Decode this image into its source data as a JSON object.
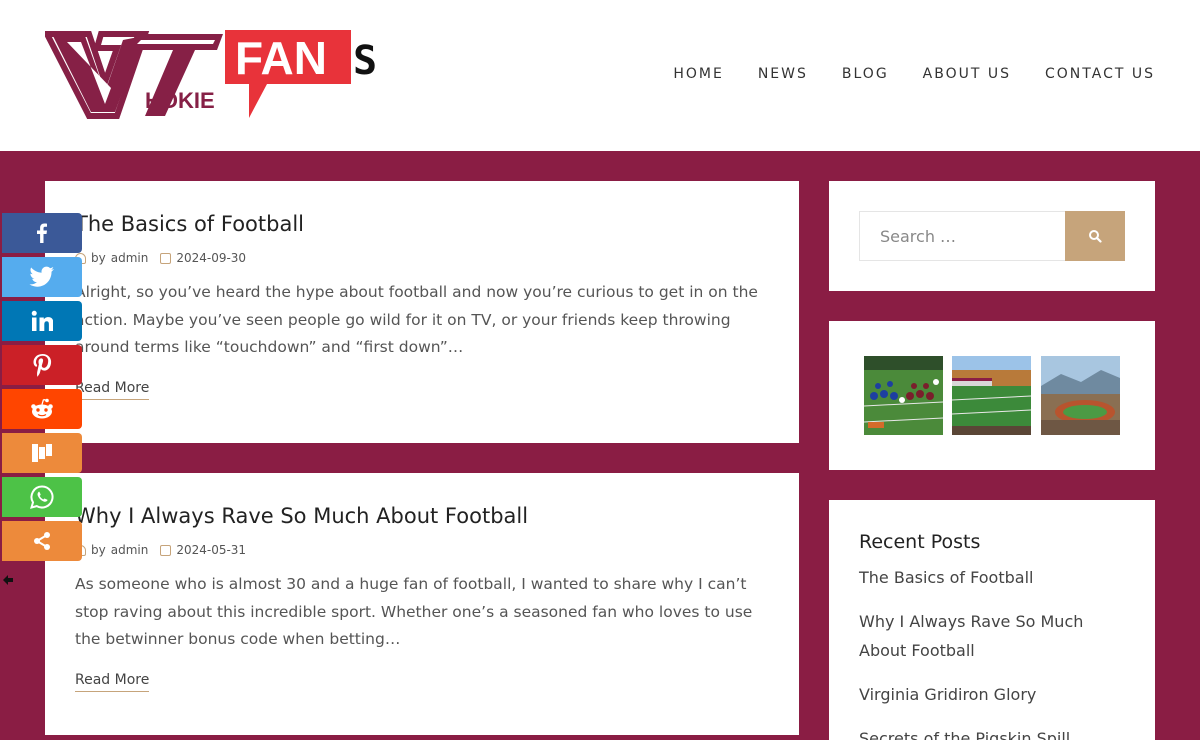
{
  "site": {
    "logo_text_vt": "VT",
    "logo_text_hokie": "HOKIE",
    "logo_text_fan": "FAN",
    "logo_text_s": "S"
  },
  "nav": {
    "items": [
      "HOME",
      "NEWS",
      "BLOG",
      "ABOUT US",
      "CONTACT US"
    ]
  },
  "posts": [
    {
      "title": "The Basics of Football",
      "author_prefix": "by",
      "author": "admin",
      "date": "2024-09-30",
      "excerpt": "Alright, so you’ve heard the hype about football and now you’re curious to get in on the action. Maybe you’ve seen people go wild for it on TV, or your friends keep throwing around terms like “touchdown” and “first down”…",
      "read_more": "Read More"
    },
    {
      "title": "Why I Always Rave So Much About Football",
      "author_prefix": "by",
      "author": "admin",
      "date": "2024-05-31",
      "excerpt": "As someone who is almost 30 and a huge fan of football, I wanted to share why I can’t stop raving about this incredible sport. Whether one’s a seasoned fan who loves to use the betwinner bonus code when betting…",
      "read_more": "Read More"
    }
  ],
  "sidebar": {
    "search": {
      "placeholder": "Search …"
    },
    "recent_posts": {
      "title": "Recent Posts",
      "items": [
        "The Basics of Football",
        "Why I Always Rave So Much About Football",
        "Virginia Gridiron Glory",
        "Secrets of the Pigskin Spill"
      ]
    }
  },
  "colors": {
    "background": "#8a1d44",
    "accent": "#c6a47b",
    "logo_maroon": "#862046",
    "logo_red": "#e8333a"
  },
  "share": {
    "buttons": [
      {
        "name": "facebook",
        "color": "#3b5998",
        "glyph": "f"
      },
      {
        "name": "twitter",
        "color": "#55acee",
        "glyph": "twitter"
      },
      {
        "name": "linkedin",
        "color": "#0077b5",
        "glyph": "in"
      },
      {
        "name": "pinterest",
        "color": "#cb2027",
        "glyph": "P"
      },
      {
        "name": "reddit",
        "color": "#ff4500",
        "glyph": "reddit"
      },
      {
        "name": "mix",
        "color": "#ed8a3b",
        "glyph": "m"
      },
      {
        "name": "whatsapp",
        "color": "#4dc247",
        "glyph": "whatsapp"
      },
      {
        "name": "more",
        "color": "#ed8a3b",
        "glyph": "share"
      }
    ]
  }
}
